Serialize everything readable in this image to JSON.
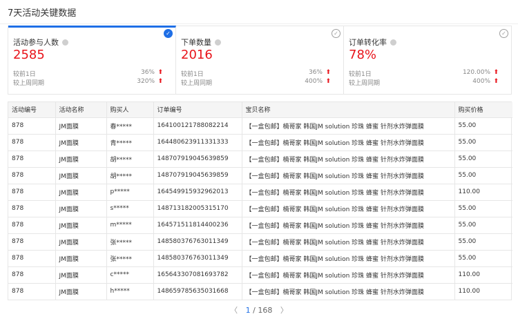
{
  "page": {
    "title": "7天活动关键数据"
  },
  "cards": [
    {
      "label": "活动参与人数",
      "value": "2585",
      "checked": true,
      "rows": [
        {
          "label": "较前1日",
          "value": "36%"
        },
        {
          "label": "较上周同期",
          "value": "320%"
        }
      ]
    },
    {
      "label": "下单数量",
      "value": "2016",
      "checked": false,
      "rows": [
        {
          "label": "较前1日",
          "value": "36%"
        },
        {
          "label": "较上周同期",
          "value": "400%"
        }
      ]
    },
    {
      "label": "订单转化率",
      "value": "78%",
      "checked": false,
      "rows": [
        {
          "label": "较前1日",
          "value": "120.00%"
        },
        {
          "label": "较上周同期",
          "value": "400%"
        }
      ]
    }
  ],
  "table": {
    "headers": [
      "活动编号",
      "活动名称",
      "购买人",
      "订单编号",
      "宝贝名称",
      "购买价格"
    ],
    "rows": [
      [
        "878",
        "JM面膜",
        "春*****",
        "164100121788082214",
        "【一盒包邮】楠哥家 韩国JM solution 珍珠 蜂蜜 针剂水炸弹面膜",
        "55.00"
      ],
      [
        "878",
        "JM面膜",
        "青*****",
        "164480623911331333",
        "【一盒包邮】楠哥家 韩国JM solution 珍珠 蜂蜜 针剂水炸弹面膜",
        "55.00"
      ],
      [
        "878",
        "JM面膜",
        "胡*****",
        "148707919045639859",
        "【一盒包邮】楠哥家 韩国JM solution 珍珠 蜂蜜 针剂水炸弹面膜",
        "55.00"
      ],
      [
        "878",
        "JM面膜",
        "胡*****",
        "148707919045639859",
        "【一盒包邮】楠哥家 韩国JM solution 珍珠 蜂蜜 针剂水炸弹面膜",
        "55.00"
      ],
      [
        "878",
        "JM面膜",
        "p*****",
        "164549915932962013",
        "【一盒包邮】楠哥家 韩国JM solution 珍珠 蜂蜜 针剂水炸弹面膜",
        "110.00"
      ],
      [
        "878",
        "JM面膜",
        "s*****",
        "148713182005315170",
        "【一盒包邮】楠哥家 韩国JM solution 珍珠 蜂蜜 针剂水炸弹面膜",
        "55.00"
      ],
      [
        "878",
        "JM面膜",
        "m*****",
        "164571511814400236",
        "【一盒包邮】楠哥家 韩国JM solution 珍珠 蜂蜜 针剂水炸弹面膜",
        "55.00"
      ],
      [
        "878",
        "JM面膜",
        "张*****",
        "148580376763011349",
        "【一盒包邮】楠哥家 韩国JM solution 珍珠 蜂蜜 针剂水炸弹面膜",
        "55.00"
      ],
      [
        "878",
        "JM面膜",
        "张*****",
        "148580376763011349",
        "【一盒包邮】楠哥家 韩国JM solution 珍珠 蜂蜜 针剂水炸弹面膜",
        "55.00"
      ],
      [
        "878",
        "JM面膜",
        "c*****",
        "165643307081693782",
        "【一盒包邮】楠哥家 韩国JM solution 珍珠 蜂蜜 针剂水炸弹面膜",
        "110.00"
      ],
      [
        "878",
        "JM面膜",
        "h*****",
        "148659785635031668",
        "【一盒包邮】楠哥家 韩国JM solution 珍珠 蜂蜜 针剂水炸弹面膜",
        "110.00"
      ]
    ]
  },
  "pagination": {
    "current": "1",
    "total": "168"
  },
  "colors": {
    "accent": "#1f6fe6",
    "value_red": "#e8131a"
  }
}
